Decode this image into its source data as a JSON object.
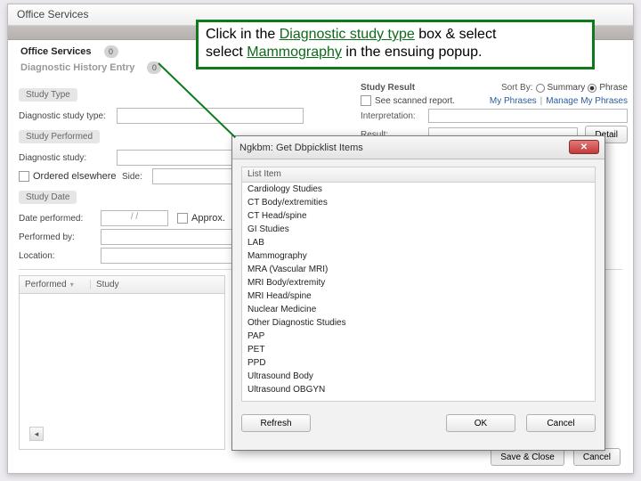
{
  "window": {
    "title": "Office Services"
  },
  "header_blur": "",
  "tabs": {
    "office_services": {
      "label": "Office Services",
      "badge": "0"
    },
    "diag_history": {
      "label": "Diagnostic History Entry",
      "badge": "0"
    }
  },
  "sections": {
    "study_type": "Study Type",
    "study_performed": "Study Performed",
    "study_date": "Study Date"
  },
  "labels": {
    "diag_study_type": "Diagnostic study type:",
    "diag_study": "Diagnostic study:",
    "ordered_elsewhere": "Ordered elsewhere",
    "side": "Side:",
    "date_performed": "Date performed:",
    "approx_chk": "Approx.",
    "performed_by": "Performed by:",
    "location": "Location:"
  },
  "values": {
    "date_performed": "/  /"
  },
  "right": {
    "study_result": "Study Result",
    "sortby": "Sort By:",
    "sort_summary": "Summary",
    "sort_phrase": "Phrase",
    "see_scanned": "See scanned report.",
    "my_phrases": "My Phrases",
    "manage_phrases": "Manage My Phrases",
    "interpretation": "Interpretation:",
    "result": "Result:",
    "detail_btn": "Detail"
  },
  "grid": {
    "col1": "Performed",
    "col2": "Study"
  },
  "footer": {
    "save_close": "Save & Close",
    "cancel": "Cancel"
  },
  "callout": {
    "p1a": "Click in the ",
    "p1b": "Diagnostic study type",
    "p1c": " box & select ",
    "p2a": "Mammography",
    "p2b": " in the ensuing popup."
  },
  "popup": {
    "title": "Ngkbm: Get Dbpicklist Items",
    "list_header": "List Item",
    "items": [
      "Cardiology Studies",
      "CT Body/extremities",
      "CT Head/spine",
      "GI Studies",
      "LAB",
      "Mammography",
      "MRA (Vascular MRI)",
      "MRI Body/extremity",
      "MRI Head/spine",
      "Nuclear Medicine",
      "Other Diagnostic Studies",
      "PAP",
      "PET",
      "PPD",
      "Ultrasound Body",
      "Ultrasound OBGYN"
    ],
    "refresh": "Refresh",
    "ok": "OK",
    "cancel": "Cancel"
  }
}
